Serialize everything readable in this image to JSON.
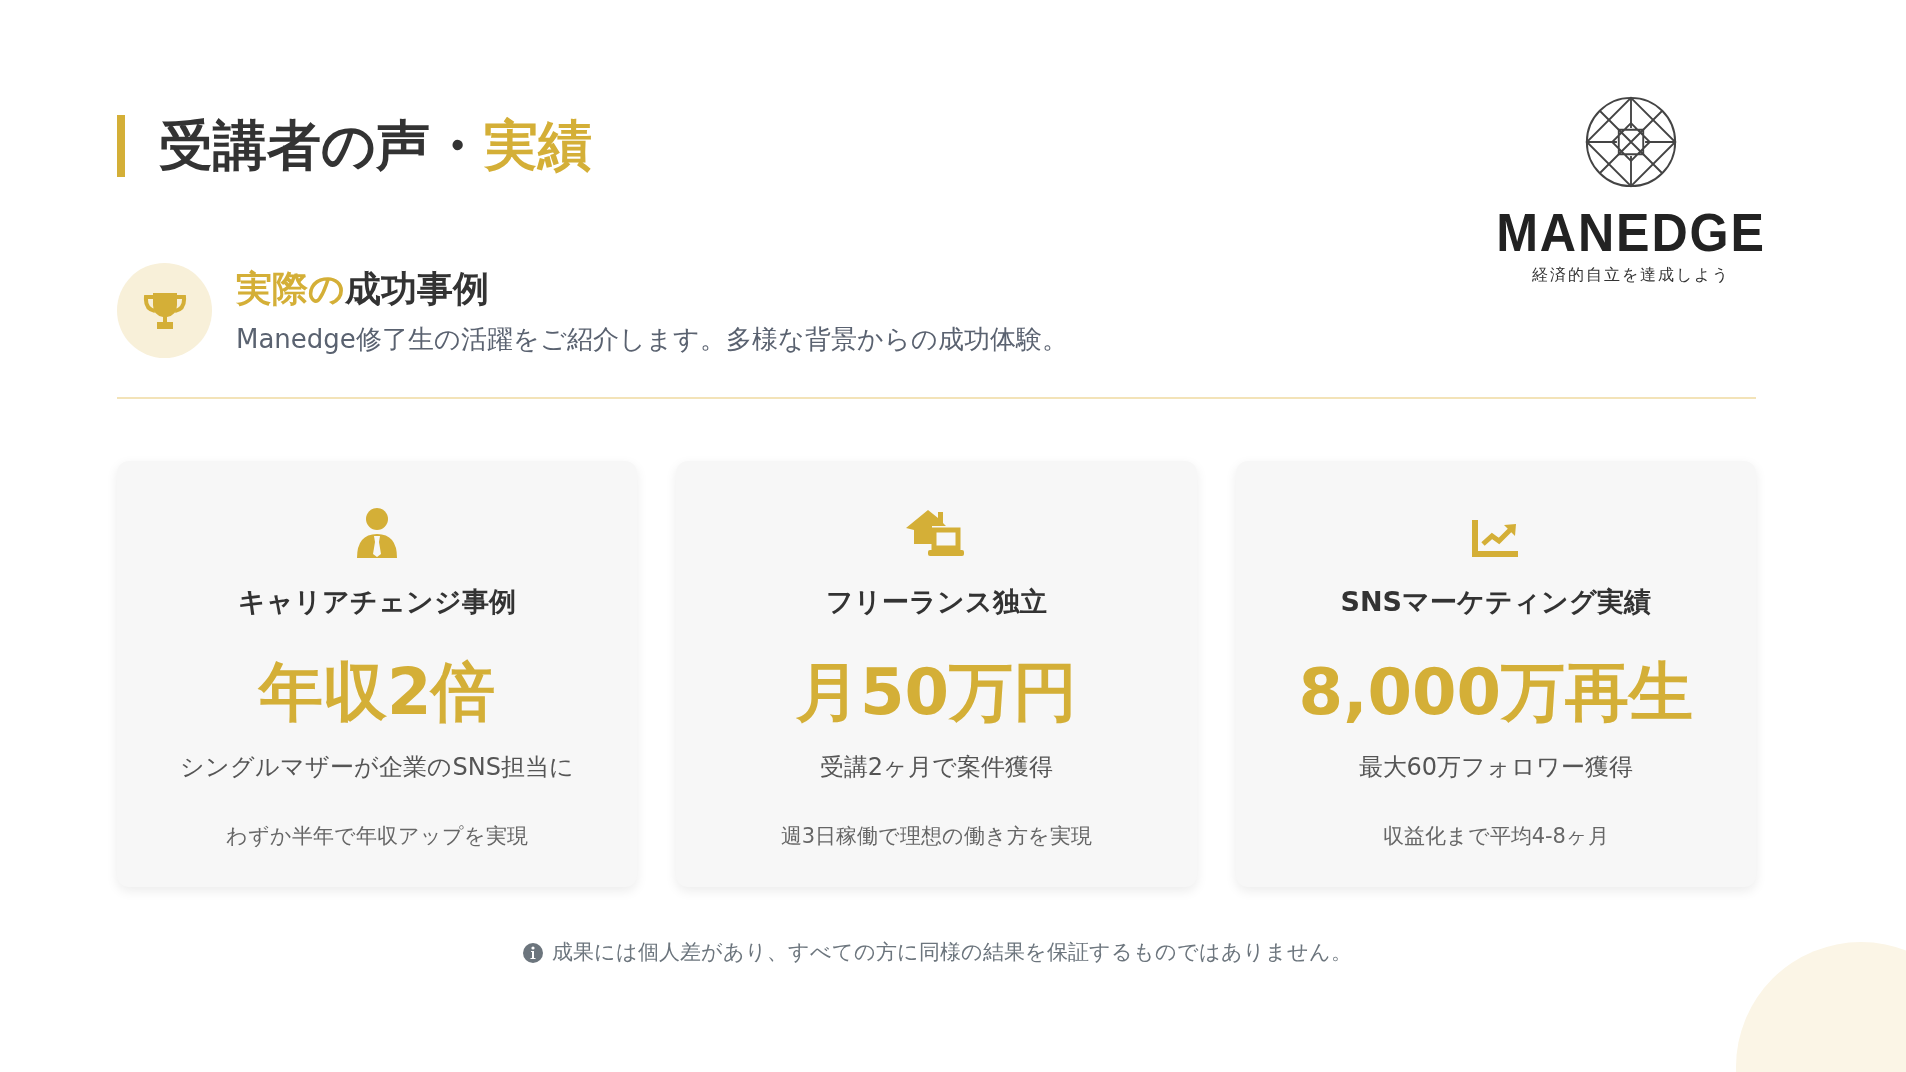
{
  "header": {
    "title": "受講者の声・",
    "title_highlight": "実績"
  },
  "logo": {
    "name": "MANEDGE",
    "tagline": "経済的自立を達成しよう"
  },
  "intro": {
    "heading_highlight": "実際の",
    "heading": "成功事例",
    "description": "Manedge修了生の活躍をご紹介します。多様な背景からの成功体験。"
  },
  "cards": [
    {
      "title": "キャリアチェンジ事例",
      "figure": "年収2倍",
      "summary": "シングルマザーが企業のSNS担当に",
      "detail": "わずか半年で年収アップを実現"
    },
    {
      "title": "フリーランス独立",
      "figure": "月50万円",
      "summary": "受講2ヶ月で案件獲得",
      "detail": "週3日稼働で理想の働き方を実現"
    },
    {
      "title": "SNSマーケティング実績",
      "figure": "8,000万再生",
      "summary": "最大60万フォロワー獲得",
      "detail": "収益化まで平均4-8ヶ月"
    }
  ],
  "disclaimer": "成果には個人差があり、すべての方に同様の結果を保証するものではありません。"
}
